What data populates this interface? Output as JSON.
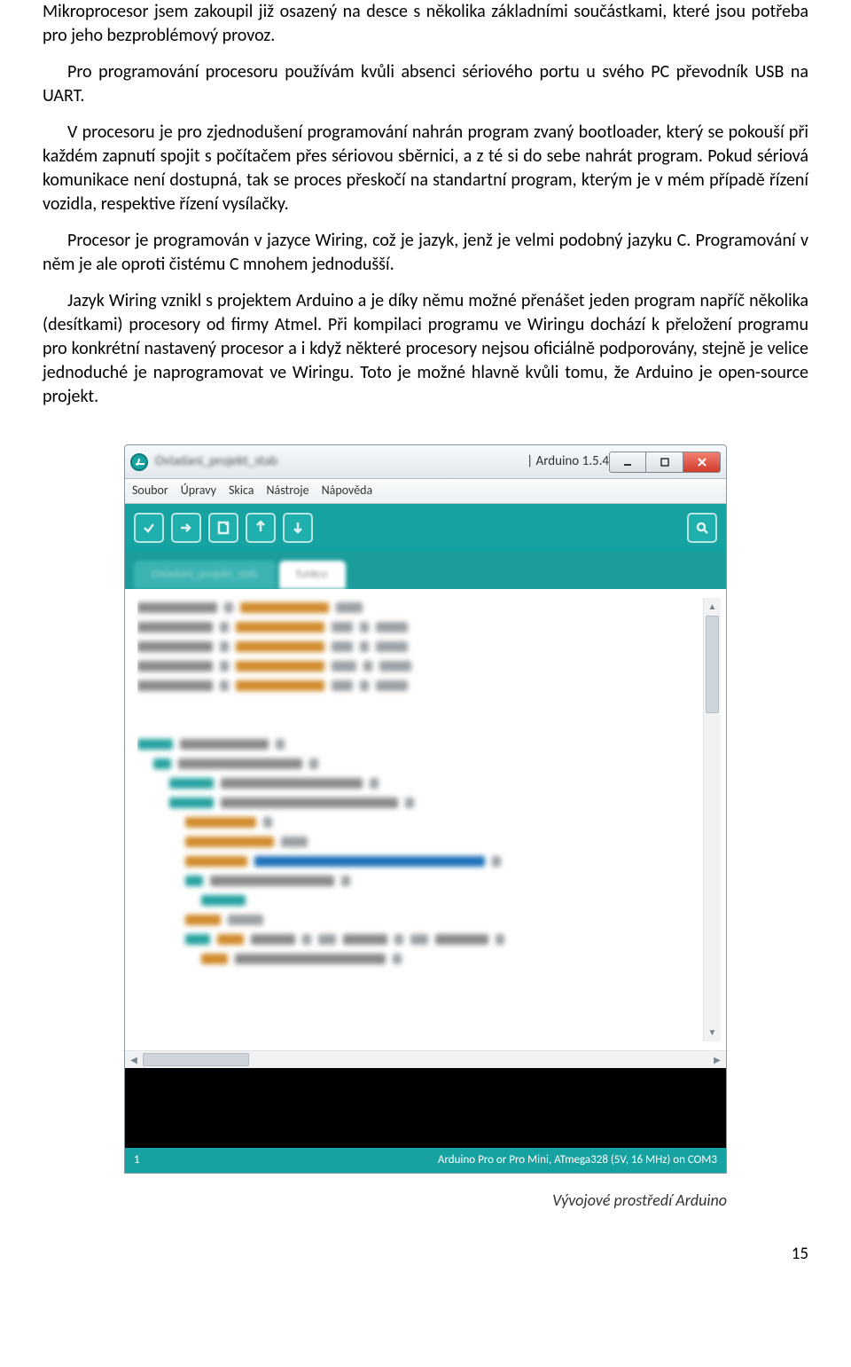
{
  "paragraphs": {
    "p1": "Mikroprocesor jsem zakoupil již osazený na desce s několika základními součástkami, které jsou potřeba pro jeho bezproblémový provoz.",
    "p2": "Pro programování procesoru používám kvůli absenci sériového portu u svého PC převodník USB na UART.",
    "p3": "V procesoru je pro zjednodušení programování nahrán program zvaný bootloader, který se pokouší při každém zapnutí spojit s počítačem přes sériovou sběrnici, a z té si do sebe nahrát program. Pokud sériová komunikace není dostupná, tak se proces přeskočí na standartní program, kterým je v mém případě řízení vozidla, respektive řízení vysílačky.",
    "p4": "Procesor je programován v jazyce Wiring, což je jazyk, jenž je velmi podobný jazyku C. Programování v něm je ale oproti čistému C mnohem jednodušší.",
    "p5": "Jazyk Wiring vznikl s projektem Arduino a je díky němu možné přenášet jeden program napříč několika (desítkami) procesory od firmy Atmel. Při kompilaci programu ve Wiringu dochází k přeložení programu pro konkrétní nastavený procesor a i když některé procesory nejsou oficiálně podporovány, stejně je velice jednoduché je naprogramovat ve Wiringu. Toto je možné hlavně kvůli tomu, že Arduino je open-source projekt."
  },
  "ide": {
    "title_blurred": "Ovladani_projekt_stab",
    "title_clear": "| Arduino 1.5.4",
    "menu": [
      "Soubor",
      "Úpravy",
      "Skica",
      "Nástroje",
      "Nápověda"
    ],
    "tabs": {
      "inactive": "Ovladani_projekt_stab",
      "active": "funkce"
    },
    "status_left": "1",
    "status_right": "Arduino Pro or Pro Mini, ATmega328 (5V, 16 MHz) on COM3"
  },
  "caption": "Vývojové prostředí Arduino",
  "page_number": "15"
}
